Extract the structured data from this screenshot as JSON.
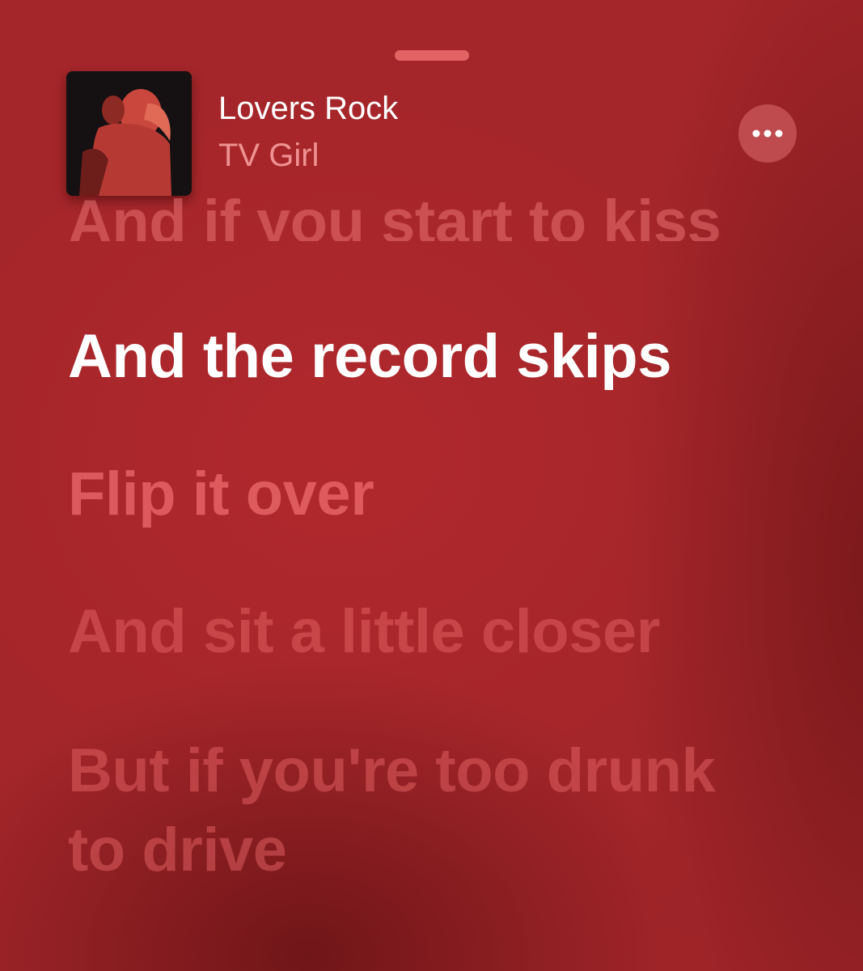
{
  "now_playing": {
    "title": "Lovers Rock",
    "artist": "TV Girl"
  },
  "lyrics": {
    "previous": "And if you start to kiss",
    "current": "And the record skips",
    "upcoming": [
      "Flip it over",
      "And sit a little closer",
      "But if you're too drunk",
      "to drive"
    ]
  },
  "icons": {
    "more": "ellipsis-icon",
    "artwork": "album-art"
  },
  "colors": {
    "background": "#a4262a",
    "active_lyric": "#ffffff"
  }
}
